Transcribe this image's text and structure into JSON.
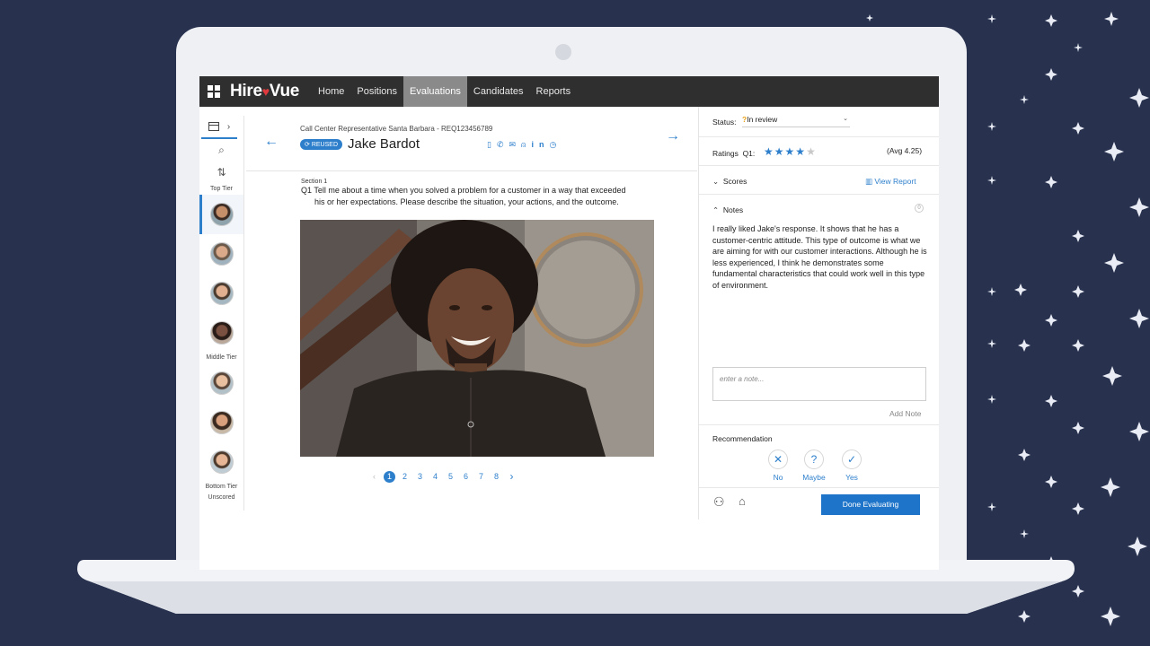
{
  "nav": {
    "brand": "Hire",
    "brand_suffix": "Vue",
    "tabs": [
      "Home",
      "Positions",
      "Evaluations",
      "Candidates",
      "Reports"
    ],
    "active_tab": "Evaluations"
  },
  "sidebar": {
    "top_tier_label": "Top Tier",
    "middle_tier_label": "Middle Tier",
    "bottom_tier_label": "Bottom Tier",
    "unscored_label": "Unscored"
  },
  "header": {
    "position": "Call Center Representative Santa Barbara - REQ123456789",
    "badge": "REUSED",
    "candidate_name": "Jake Bardot",
    "contact_icons": [
      "document-icon",
      "phone-icon",
      "email-icon",
      "person-icon",
      "linkedin-icon",
      "clock-icon"
    ],
    "linkedin_text": "in"
  },
  "question": {
    "section": "Section 1",
    "text": "Q1 Tell me about a time when you solved a problem for a customer in a way that exceeded his or her expectations. Please describe the situation, your actions, and the outcome."
  },
  "pager": {
    "pages": [
      "1",
      "2",
      "3",
      "4",
      "5",
      "6",
      "7",
      "8"
    ],
    "current": "1"
  },
  "panel": {
    "status_label": "Status:",
    "status_icon": "?",
    "status_value": "In review",
    "ratings_label": "Ratings",
    "ratings_q": "Q1:",
    "rating": 4,
    "rating_max": 5,
    "avg": "(Avg 4.25)",
    "scores_label": "Scores",
    "view_report": "View Report",
    "notes_label": "Notes",
    "notes_count": "0",
    "notes_text": "I really liked Jake's response. It shows that he has a customer-centric attitude. This type of outcome is what we are aiming for with our customer interactions. Although he is less experienced, I think he demonstrates some fundamental characteristics that could work well in this type of environment.",
    "note_placeholder": "enter a note...",
    "add_note": "Add Note",
    "recommendation_label": "Recommendation",
    "rec_no": "No",
    "rec_maybe": "Maybe",
    "rec_yes": "Yes",
    "done_button": "Done Evaluating"
  },
  "colors": {
    "accent": "#2d7fcc",
    "topbar": "#2f2f2f",
    "background": "#28324f"
  }
}
